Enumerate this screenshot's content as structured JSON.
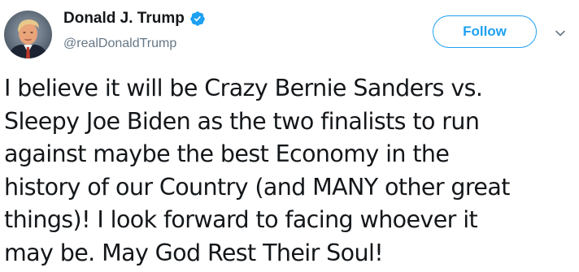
{
  "user": {
    "display_name": "Donald J. Trump",
    "handle": "@realDonaldTrump",
    "verified": true,
    "avatar_icon": "user-avatar-photo"
  },
  "actions": {
    "follow_label": "Follow",
    "menu_icon": "chevron-down-icon"
  },
  "colors": {
    "accent": "#1da1f2",
    "text": "#14171a",
    "secondary_text": "#657786"
  },
  "tweet": {
    "lines": [
      "I believe it will be Crazy Bernie Sanders vs.",
      "Sleepy Joe Biden as the two finalists to run",
      "against maybe the best Economy in the",
      "history of our Country (and MANY other great",
      "things)! I look forward to facing whoever it",
      "may be. May God Rest Their Soul!"
    ]
  }
}
